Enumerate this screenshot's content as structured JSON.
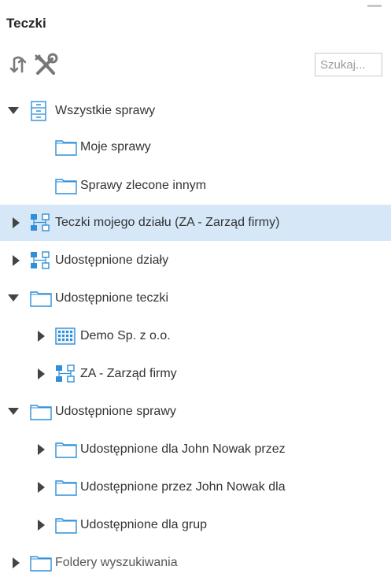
{
  "panel": {
    "title": "Teczki",
    "search_placeholder": "Szukaj..."
  },
  "tree": {
    "items": [
      {
        "label": "Wszystkie sprawy",
        "icon": "cabinet-icon",
        "expanded": true
      },
      {
        "label": "Moje sprawy",
        "icon": "folder-icon"
      },
      {
        "label": "Sprawy zlecone innym",
        "icon": "folder-icon"
      },
      {
        "label": "Teczki mojego działu (ZA - Zarząd firmy)",
        "icon": "org-chart-icon",
        "expanded": false,
        "selected": true
      },
      {
        "label": "Udostępnione działy",
        "icon": "org-chart-icon",
        "expanded": false
      },
      {
        "label": "Udostępnione teczki",
        "icon": "folder-icon",
        "expanded": true
      },
      {
        "label": "Demo Sp. z o.o.",
        "icon": "building-icon",
        "expanded": false
      },
      {
        "label": "ZA - Zarząd firmy",
        "icon": "org-chart-icon",
        "expanded": false
      },
      {
        "label": "Udostępnione sprawy",
        "icon": "folder-icon",
        "expanded": true
      },
      {
        "label": "Udostępnione dla John Nowak przez",
        "icon": "folder-icon",
        "expanded": false
      },
      {
        "label": "Udostępnione przez John Nowak dla",
        "icon": "folder-icon",
        "expanded": false
      },
      {
        "label": "Udostępnione dla grup",
        "icon": "folder-icon",
        "expanded": false
      },
      {
        "label": "Foldery wyszukiwania",
        "icon": "folder-icon",
        "expanded": false
      }
    ]
  },
  "colors": {
    "selected_row": "#d6e8f7",
    "icon_blue": "#2f8fd8",
    "arrow": "#444444"
  }
}
